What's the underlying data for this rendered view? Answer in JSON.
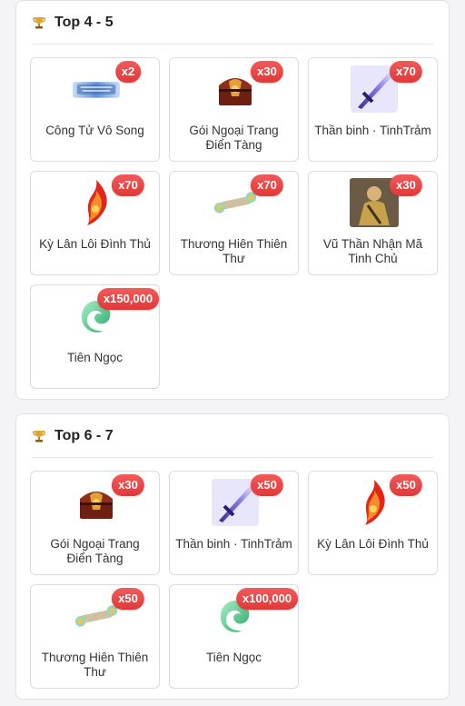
{
  "sections": [
    {
      "title": "Top 4 - 5",
      "items": [
        {
          "name": "Công Tử Vô Song",
          "qty": "x2",
          "icon": "title-banner-icon"
        },
        {
          "name": "Gói Ngoại Trang Điển Tàng",
          "qty": "x30",
          "icon": "treasure-chest-icon"
        },
        {
          "name": "Thần binh · TinhTrảm",
          "qty": "x70",
          "icon": "divine-sword-icon"
        },
        {
          "name": "Kỳ Lân Lôi Đình Thủ",
          "qty": "x70",
          "icon": "flame-gauntlet-icon"
        },
        {
          "name": "Thương Hiên Thiên Thư",
          "qty": "x70",
          "icon": "scroll-icon"
        },
        {
          "name": "Vũ Thần Nhận Mã Tinh Chủ",
          "qty": "x30",
          "icon": "warrior-portrait-icon"
        },
        {
          "name": "Tiên Ngọc",
          "qty": "x150,000",
          "icon": "jade-icon"
        }
      ]
    },
    {
      "title": "Top 6 - 7",
      "items": [
        {
          "name": "Gói Ngoại Trang Điển Tàng",
          "qty": "x30",
          "icon": "treasure-chest-icon"
        },
        {
          "name": "Thần binh · TinhTrảm",
          "qty": "x50",
          "icon": "divine-sword-icon"
        },
        {
          "name": "Kỳ Lân Lôi Đình Thủ",
          "qty": "x50",
          "icon": "flame-gauntlet-icon"
        },
        {
          "name": "Thương Hiên Thiên Thư",
          "qty": "x50",
          "icon": "scroll-icon"
        },
        {
          "name": "Tiên Ngọc",
          "qty": "x100,000",
          "icon": "jade-icon"
        }
      ]
    }
  ],
  "colors": {
    "badge": "#e84545",
    "border": "#dcdce0",
    "trophy": "#d99a1e"
  }
}
